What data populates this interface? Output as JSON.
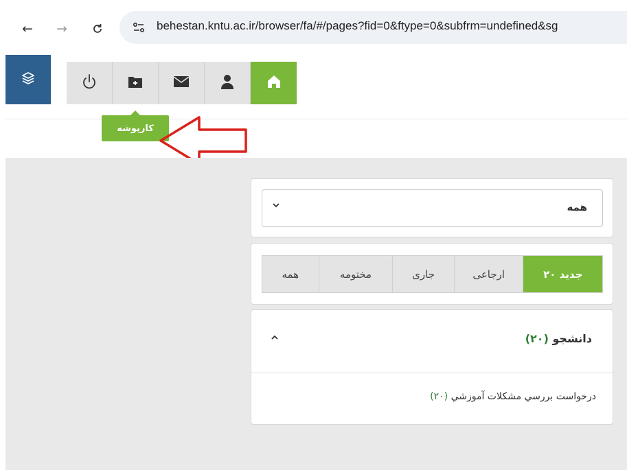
{
  "browser": {
    "url": "behestan.kntu.ac.ir/browser/fa/#/pages?fid=0&ftype=0&subfrm=undefined&sg"
  },
  "toolbar": {
    "tooltip": "کارپوشه",
    "accent_color": "#7ab839",
    "brand_color": "#2d5f8f"
  },
  "filter": {
    "selected": "همه"
  },
  "tabs": [
    {
      "label": "۲۰ جدید",
      "active": true
    },
    {
      "label": "ارجاعی",
      "active": false
    },
    {
      "label": "جاری",
      "active": false
    },
    {
      "label": "مختومه",
      "active": false
    },
    {
      "label": "همه",
      "active": false
    }
  ],
  "group": {
    "title": "دانشجو",
    "count": "(۲۰)",
    "items": [
      {
        "label": "درخواست بررسي مشكلات آموزشي",
        "count": "(۲۰)"
      }
    ]
  }
}
